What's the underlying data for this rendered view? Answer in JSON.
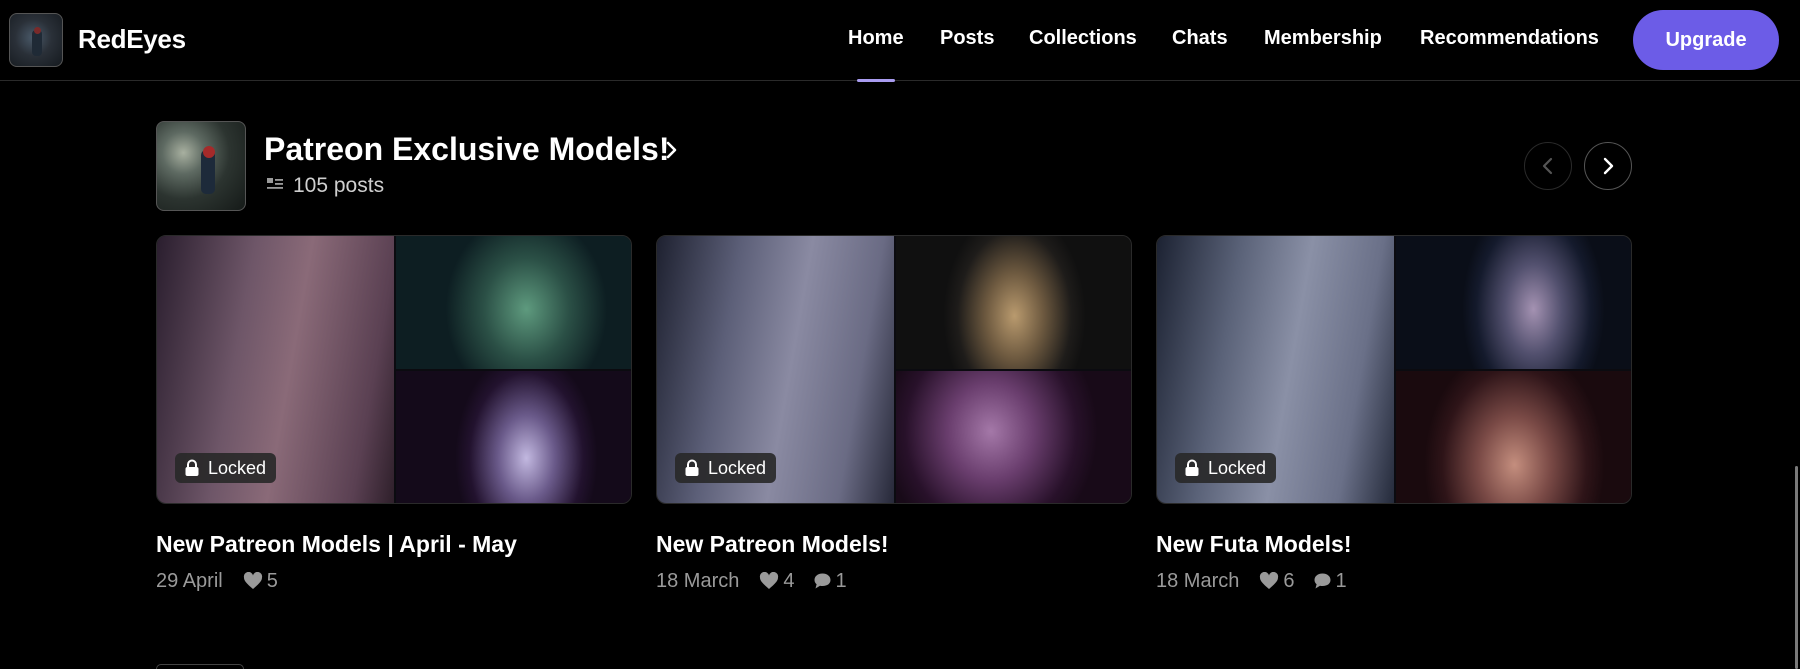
{
  "header": {
    "brand_name": "RedEyes",
    "nav": [
      {
        "label": "Home",
        "active": true
      },
      {
        "label": "Posts",
        "active": false
      },
      {
        "label": "Collections",
        "active": false
      },
      {
        "label": "Chats",
        "active": false
      },
      {
        "label": "Membership",
        "active": false
      },
      {
        "label": "Recommendations",
        "active": false
      }
    ],
    "upgrade_label": "Upgrade",
    "accent_color": "#6c5ce7"
  },
  "collection": {
    "title": "Patreon Exclusive Models!",
    "posts_count": "105 posts",
    "prev_icon": "chevron-left-icon",
    "next_icon": "chevron-right-icon"
  },
  "cards": [
    {
      "title": "New Patreon Models | April - May",
      "date": "29 April",
      "likes": "5",
      "comments": null,
      "locked_label": "Locked"
    },
    {
      "title": "New Patreon Models!",
      "date": "18 March",
      "likes": "4",
      "comments": "1",
      "locked_label": "Locked"
    },
    {
      "title": "New Futa Models!",
      "date": "18 March",
      "likes": "6",
      "comments": "1",
      "locked_label": "Locked"
    }
  ]
}
